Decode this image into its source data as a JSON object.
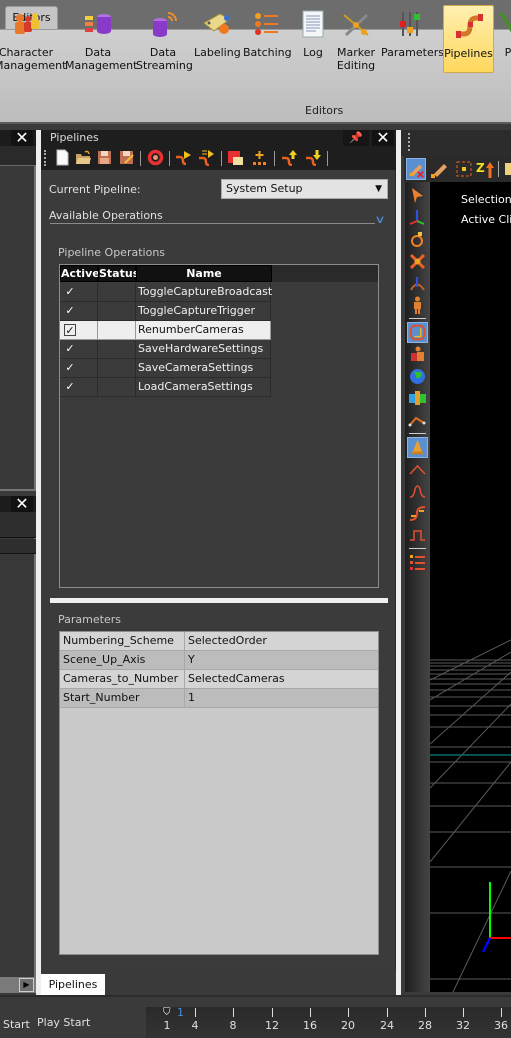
{
  "ribbon": {
    "tab": "Editors",
    "group_label": "Editors",
    "buttons": [
      {
        "label": "Character\nManagement",
        "line1": "Character",
        "line2": "Management",
        "icon": "character-management-icon"
      },
      {
        "label": "Data Management",
        "line1": "Data",
        "line2": "Management",
        "icon": "data-management-icon"
      },
      {
        "label": "Data Streaming",
        "line1": "Data",
        "line2": "Streaming",
        "icon": "data-streaming-icon"
      },
      {
        "label": "Labeling",
        "line1": "Labeling",
        "line2": "",
        "icon": "labeling-icon"
      },
      {
        "label": "Batching",
        "line1": "Batching",
        "line2": "",
        "icon": "batching-icon"
      },
      {
        "label": "Log",
        "line1": "Log",
        "line2": "",
        "icon": "log-icon"
      },
      {
        "label": "Marker Editing",
        "line1": "Marker",
        "line2": "Editing",
        "icon": "marker-editing-icon"
      },
      {
        "label": "Parameters",
        "line1": "Parameters",
        "line2": "",
        "icon": "parameters-icon"
      },
      {
        "label": "Pipelines",
        "line1": "Pipelines",
        "line2": "",
        "icon": "pipelines-icon",
        "active": true
      },
      {
        "label": "P",
        "line1": "P",
        "line2": "",
        "icon": "probe-icon"
      }
    ]
  },
  "pipelines_panel": {
    "title": "Pipelines",
    "close_glyph": "✕",
    "toolbar": [
      "new-icon",
      "open-icon",
      "save-icon",
      "save-as-icon",
      "refresh-icon",
      "run-icon",
      "run-all-icon",
      "marker-icon",
      "add-operation-icon",
      "move-up-icon",
      "move-down-icon"
    ],
    "current_pipeline_label": "Current Pipeline:",
    "current_pipeline_value": "System Setup",
    "available_operations_label": "Available Operations",
    "pipeline_operations_label": "Pipeline Operations",
    "columns": [
      "Active",
      "Status",
      "Name"
    ],
    "operations": [
      {
        "active": true,
        "status": "",
        "name": "ToggleCaptureBroadcast"
      },
      {
        "active": true,
        "status": "",
        "name": "ToggleCaptureTrigger"
      },
      {
        "active": true,
        "status": "",
        "name": "RenumberCameras",
        "selected": true
      },
      {
        "active": true,
        "status": "",
        "name": "SaveHardwareSettings"
      },
      {
        "active": true,
        "status": "",
        "name": "SaveCameraSettings"
      },
      {
        "active": true,
        "status": "",
        "name": "LoadCameraSettings"
      }
    ],
    "parameters_label": "Parameters",
    "parameters": [
      {
        "key": "Numbering_Scheme",
        "value": "SelectedOrder"
      },
      {
        "key": "Scene_Up_Axis",
        "value": "Y"
      },
      {
        "key": "Cameras_to_Number",
        "value": "SelectedCameras"
      },
      {
        "key": "Start_Number",
        "value": "1"
      }
    ],
    "bottom_tab": "Pipelines"
  },
  "viewport": {
    "selection_label": "Selection:",
    "active_clip_label": "Active Clip"
  },
  "timeline": {
    "start_label": "Start",
    "play_start_label": "Play Start",
    "current_frame": "1",
    "ticks": [
      "1",
      "4",
      "8",
      "12",
      "16",
      "20",
      "24",
      "28",
      "32",
      "36"
    ]
  },
  "colors": {
    "accent": "#4a8ed8",
    "active_ribbon": "#ffd75c",
    "axis_x": "#ff0000",
    "axis_y": "#00ff00",
    "axis_z": "#0000ff"
  }
}
